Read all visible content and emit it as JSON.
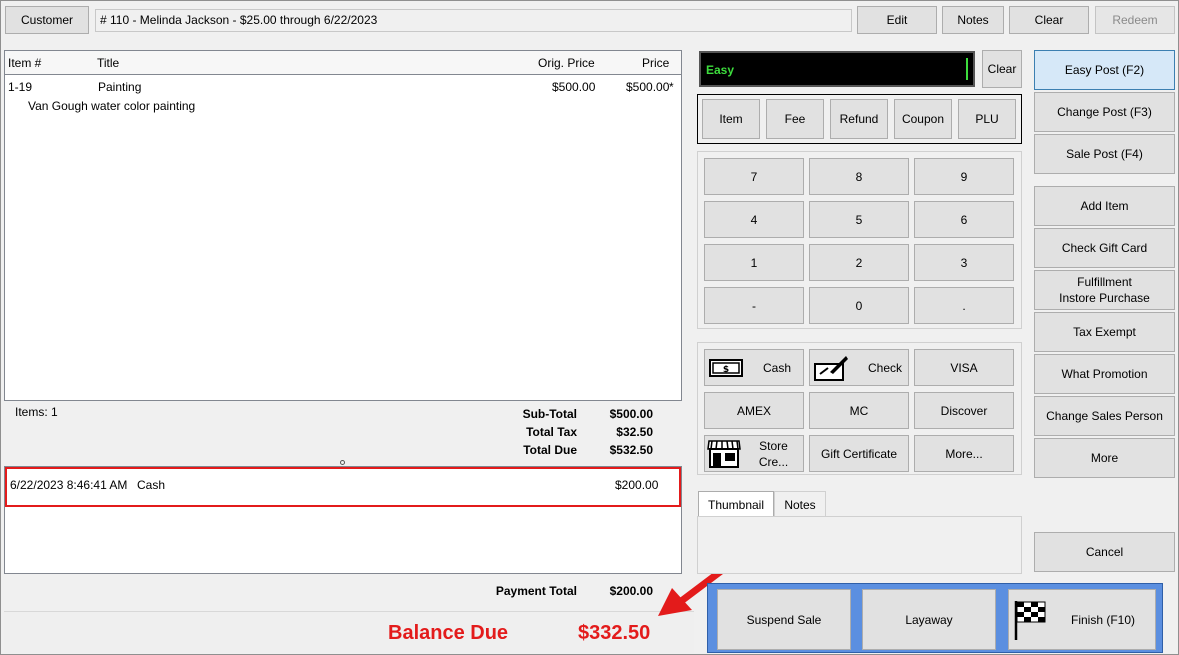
{
  "header": {
    "customer_button": "Customer",
    "customer_info": "# 110 - Melinda Jackson -  $25.00 through 6/22/2023",
    "edit_button": "Edit",
    "notes_button": "Notes",
    "clear_button": "Clear",
    "redeem_button": "Redeem"
  },
  "items_table": {
    "columns": [
      "Item #",
      "Title",
      "Orig. Price",
      "Price"
    ],
    "rows": [
      {
        "item_no": "1-19",
        "title": "Painting",
        "orig_price": "$500.00",
        "price": "$500.00",
        "flag": "*",
        "description": "Van Gough water color painting"
      }
    ]
  },
  "totals": {
    "items_label": "Items: 1",
    "subtotal_label": "Sub-Total",
    "subtotal_value": "$500.00",
    "tax_label": "Total Tax",
    "tax_value": "$32.50",
    "due_label": "Total Due",
    "due_value": "$532.50"
  },
  "payments": {
    "rows": [
      {
        "datetime": "6/22/2023 8:46:41 AM",
        "method": "Cash",
        "amount": "$200.00"
      }
    ],
    "total_label": "Payment Total",
    "total_value": "$200.00"
  },
  "balance": {
    "label": "Balance Due",
    "value": "$332.50"
  },
  "entry": {
    "display_text": "Easy",
    "clear_button": "Clear"
  },
  "mode_buttons": [
    "Item",
    "Fee",
    "Refund",
    "Coupon",
    "PLU"
  ],
  "keypad": [
    "7",
    "8",
    "9",
    "4",
    "5",
    "6",
    "1",
    "2",
    "3",
    "-",
    "0",
    "."
  ],
  "tender_buttons": {
    "cash": "Cash",
    "check": "Check",
    "visa": "VISA",
    "amex": "AMEX",
    "mc": "MC",
    "discover": "Discover",
    "store_credit": "Store Cre...",
    "gift_certificate": "Gift Certificate",
    "more": "More..."
  },
  "tabs": {
    "thumbnail": "Thumbnail",
    "notes": "Notes"
  },
  "side_buttons": {
    "easy_post": "Easy Post (F2)",
    "change_post": "Change Post (F3)",
    "sale_post": "Sale Post (F4)",
    "add_item": "Add Item",
    "check_gift_card": "Check Gift Card",
    "fulfillment_line1": "Fulfillment",
    "fulfillment_line2": "Instore Purchase",
    "tax_exempt": "Tax Exempt",
    "what_promotion": "What Promotion",
    "change_sales_person": "Change Sales Person",
    "more": "More",
    "cancel": "Cancel"
  },
  "bottom_buttons": {
    "suspend_sale": "Suspend Sale",
    "layaway": "Layaway",
    "finish": "Finish (F10)"
  },
  "colors": {
    "annotation_red": "#e31b1b",
    "display_text_green": "#3ddc3d",
    "accent_blue": "#5b8fe0"
  }
}
